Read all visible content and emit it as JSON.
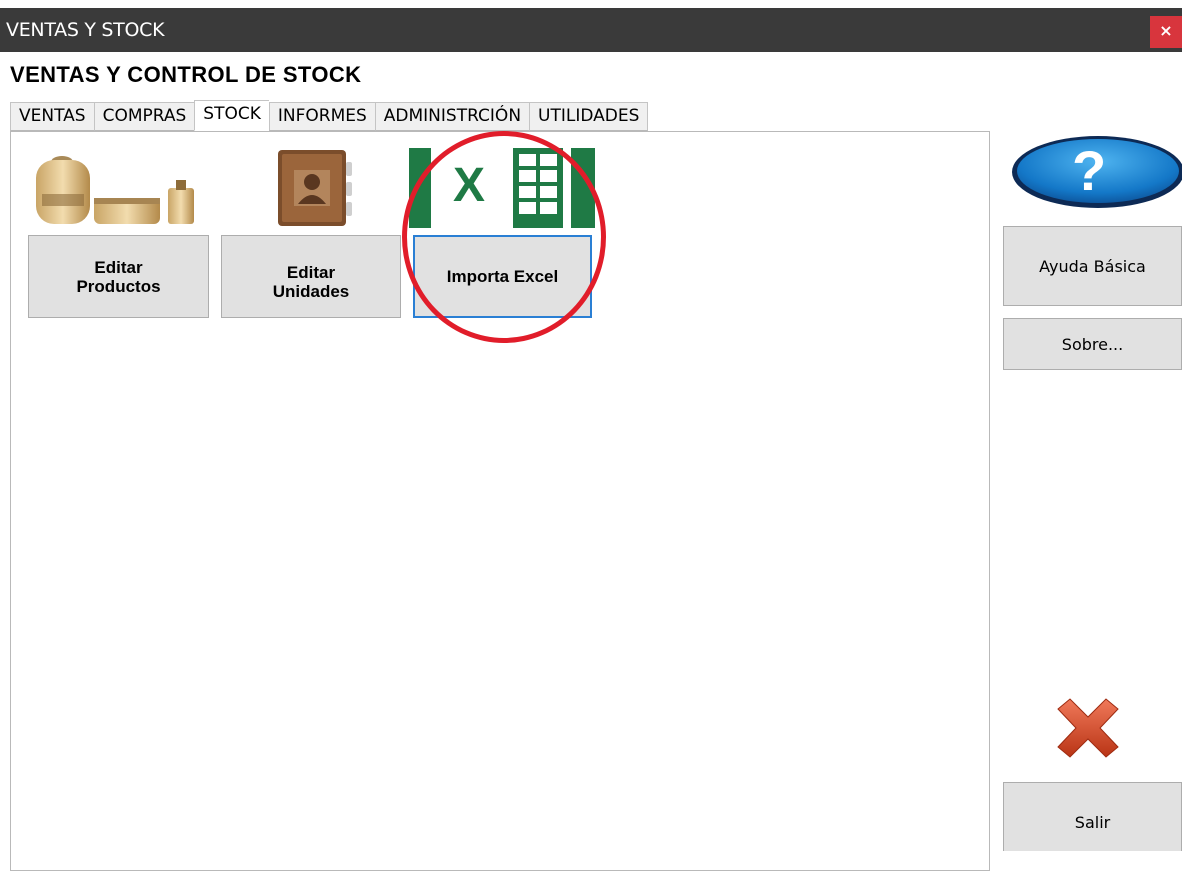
{
  "window": {
    "title": "VENTAS Y STOCK",
    "close_glyph": "×"
  },
  "app": {
    "heading": "VENTAS Y CONTROL DE STOCK"
  },
  "tabs": [
    {
      "label": "VENTAS",
      "active": false
    },
    {
      "label": "COMPRAS",
      "active": false
    },
    {
      "label": "STOCK",
      "active": true
    },
    {
      "label": "INFORMES",
      "active": false
    },
    {
      "label": "ADMINISTRCIÓN",
      "active": false
    },
    {
      "label": "UTILIDADES",
      "active": false
    }
  ],
  "stock": {
    "buttons": [
      {
        "line1": "Editar",
        "line2": "Productos",
        "icon": "products-icon"
      },
      {
        "line1": "Editar",
        "line2": "Unidades",
        "icon": "address-book-icon"
      },
      {
        "line1": "Importa Excel",
        "icon": "excel-icon"
      }
    ],
    "excel_letter": "X"
  },
  "sidebar": {
    "help_icon_glyph": "?",
    "help_label": "Ayuda Básica",
    "about_label": "Sobre...",
    "exit_label": "Salir"
  },
  "colors": {
    "titlebar": "#3a3a3a",
    "close": "#d8353d",
    "excel_green": "#1f7a45",
    "highlight": "#e11d2a",
    "focus": "#2a7fd4",
    "exit_red": "#d04a2a"
  }
}
